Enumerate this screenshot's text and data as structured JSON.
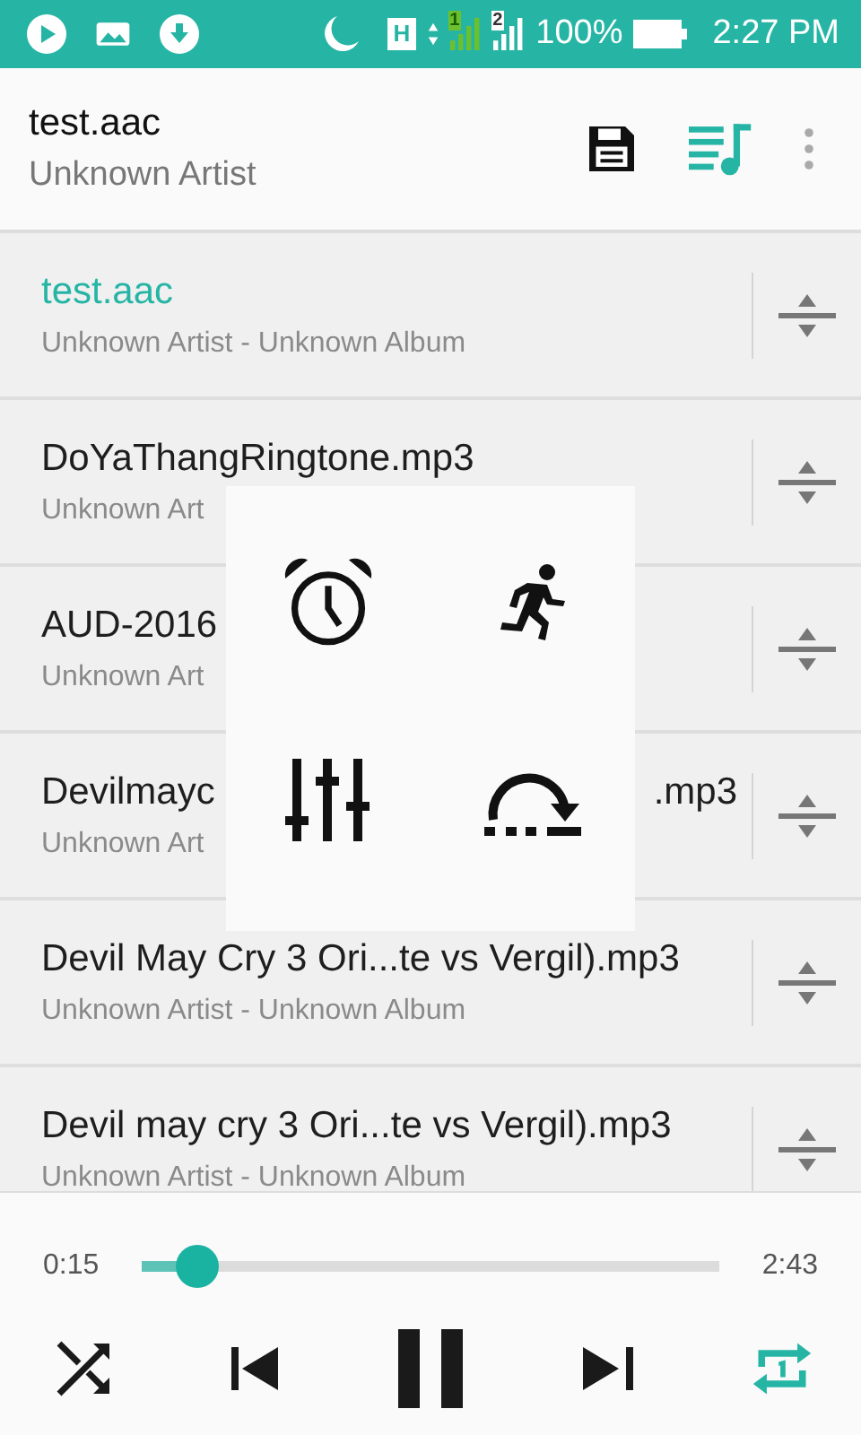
{
  "status_bar": {
    "network": "H",
    "sim_1": "1",
    "sim_2": "2",
    "battery": "100%",
    "time": "2:27 PM"
  },
  "header": {
    "title": "test.aac",
    "subtitle": "Unknown Artist"
  },
  "tracks": [
    {
      "title": "test.aac",
      "subtitle": "Unknown Artist - Unknown Album",
      "selected": true
    },
    {
      "title": "DoYaThangRingtone.mp3",
      "subtitle": "Unknown Art",
      "selected": false
    },
    {
      "title": "AUD-2016",
      "subtitle": "Unknown Art",
      "selected": false
    },
    {
      "title": "Devilmayc",
      "title_right": ".mp3",
      "subtitle": "Unknown Art",
      "selected": false
    },
    {
      "title": "Devil May Cry 3 Ori...te vs Vergil).mp3",
      "subtitle": "Unknown Artist - Unknown Album",
      "selected": false
    },
    {
      "title": "Devil may cry 3 Ori...te vs Vergil).mp3",
      "subtitle": "Unknown Artist - Unknown Album",
      "selected": false
    }
  ],
  "player": {
    "elapsed": "0:15",
    "duration": "2:43",
    "level": 0.095,
    "shuffle": false,
    "playing": true,
    "repeat_one": true
  }
}
